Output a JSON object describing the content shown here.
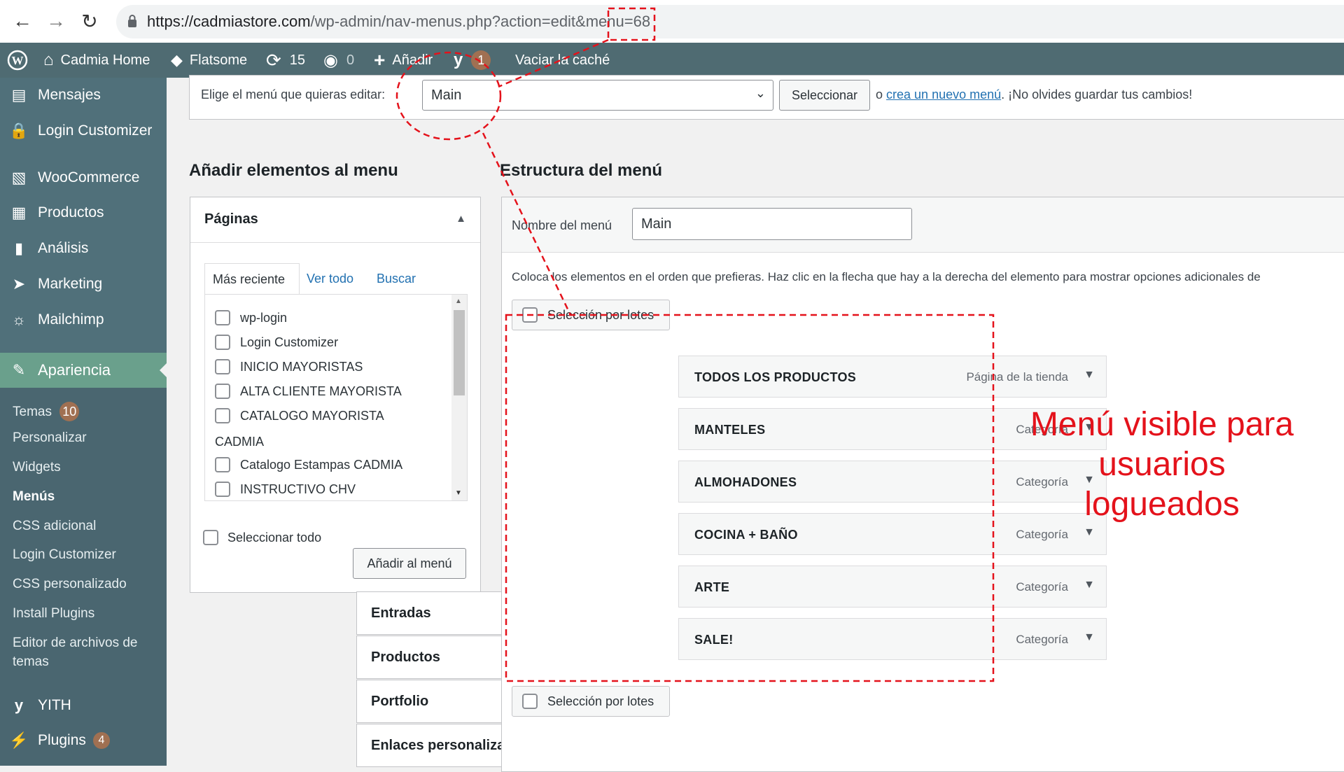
{
  "browser": {
    "url_host": "https://cadmiastore.com",
    "url_path": "/wp-admin/nav-menus.php?action=edit&menu=68",
    "back_icon": "arrow-left",
    "forward_icon": "arrow-right",
    "reload_icon": "reload"
  },
  "adminbar": {
    "site_name": "Cadmia Home",
    "theme": "Flatsome",
    "updates_count": "15",
    "comments_count": "0",
    "add_label": "Añadir",
    "yoast_count": "1",
    "cache_label": "Vaciar la caché"
  },
  "sidebar": {
    "top_items": [
      {
        "label": "Mensajes",
        "icon": "message-icon"
      },
      {
        "label": "Login Customizer",
        "icon": "lock-icon"
      },
      {
        "label": "WooCommerce",
        "icon": "woo-icon"
      },
      {
        "label": "Productos",
        "icon": "archive-icon"
      },
      {
        "label": "Análisis",
        "icon": "chart-icon"
      },
      {
        "label": "Marketing",
        "icon": "megaphone-icon"
      },
      {
        "label": "Mailchimp",
        "icon": "mailchimp-icon"
      }
    ],
    "active": {
      "label": "Apariencia",
      "icon": "brush-icon"
    },
    "submenu": [
      {
        "label": "Temas",
        "badge": "10"
      },
      {
        "label": "Personalizar"
      },
      {
        "label": "Widgets"
      },
      {
        "label": "Menús",
        "current": true
      },
      {
        "label": "CSS adicional"
      },
      {
        "label": "Login Customizer"
      },
      {
        "label": "CSS personalizado"
      },
      {
        "label": "Install Plugins"
      },
      {
        "label": "Editor de archivos de"
      },
      {
        "label": "temas"
      }
    ],
    "bottom_items": [
      {
        "label": "YITH",
        "icon": "yith-icon"
      },
      {
        "label": "Plugins",
        "icon": "plugin-icon",
        "badge": "4"
      }
    ]
  },
  "select_menu": {
    "label": "Elige el menú que quieras editar:",
    "value": "Main",
    "button": "Seleccionar",
    "or_text": "o",
    "create_link": "crea un nuevo menú",
    "reminder": ". ¡No olvides guardar tus cambios!"
  },
  "add_items": {
    "heading": "Añadir elementos al menu",
    "pages_title": "Páginas",
    "tabs": [
      "Más reciente",
      "Ver todo",
      "Buscar"
    ],
    "pages": [
      "wp-login",
      "Login Customizer",
      "INICIO MAYORISTAS",
      "ALTA CLIENTE MAYORISTA",
      "CATALOGO MAYORISTA",
      "Catalogo Estampas CADMIA",
      "INSTRUCTIVO CHV"
    ],
    "wrapped_text": "CADMIA",
    "select_all": "Seleccionar todo",
    "add_button": "Añadir al menú",
    "sections": [
      "Entradas",
      "Productos",
      "Portfolio",
      "Enlaces personalizados"
    ]
  },
  "structure": {
    "heading": "Estructura del menú",
    "name_label": "Nombre del menú",
    "name_value": "Main",
    "instructions": "Coloca los elementos en el orden que prefieras. Haz clic en la flecha que hay a la derecha del elemento para mostrar opciones adicionales de",
    "bulk_select": "Selección por lotes",
    "items": [
      {
        "title": "TODOS LOS PRODUCTOS",
        "type": "Página de la tienda"
      },
      {
        "title": "MANTELES",
        "type": "Categoría"
      },
      {
        "title": "ALMOHADONES",
        "type": "Categoría"
      },
      {
        "title": "COCINA + BAÑO",
        "type": "Categoría"
      },
      {
        "title": "ARTE",
        "type": "Categoría"
      },
      {
        "title": "SALE!",
        "type": "Categoría"
      }
    ]
  },
  "annotation": {
    "line1": "Menú visible para",
    "line2": "usuarios",
    "line3": "logueados",
    "color": "#e4121b"
  },
  "colors": {
    "admin_bar": "#4f6b72",
    "sidebar": "#50707a",
    "sidebar_active": "#6aa08c",
    "link": "#2271b1"
  }
}
